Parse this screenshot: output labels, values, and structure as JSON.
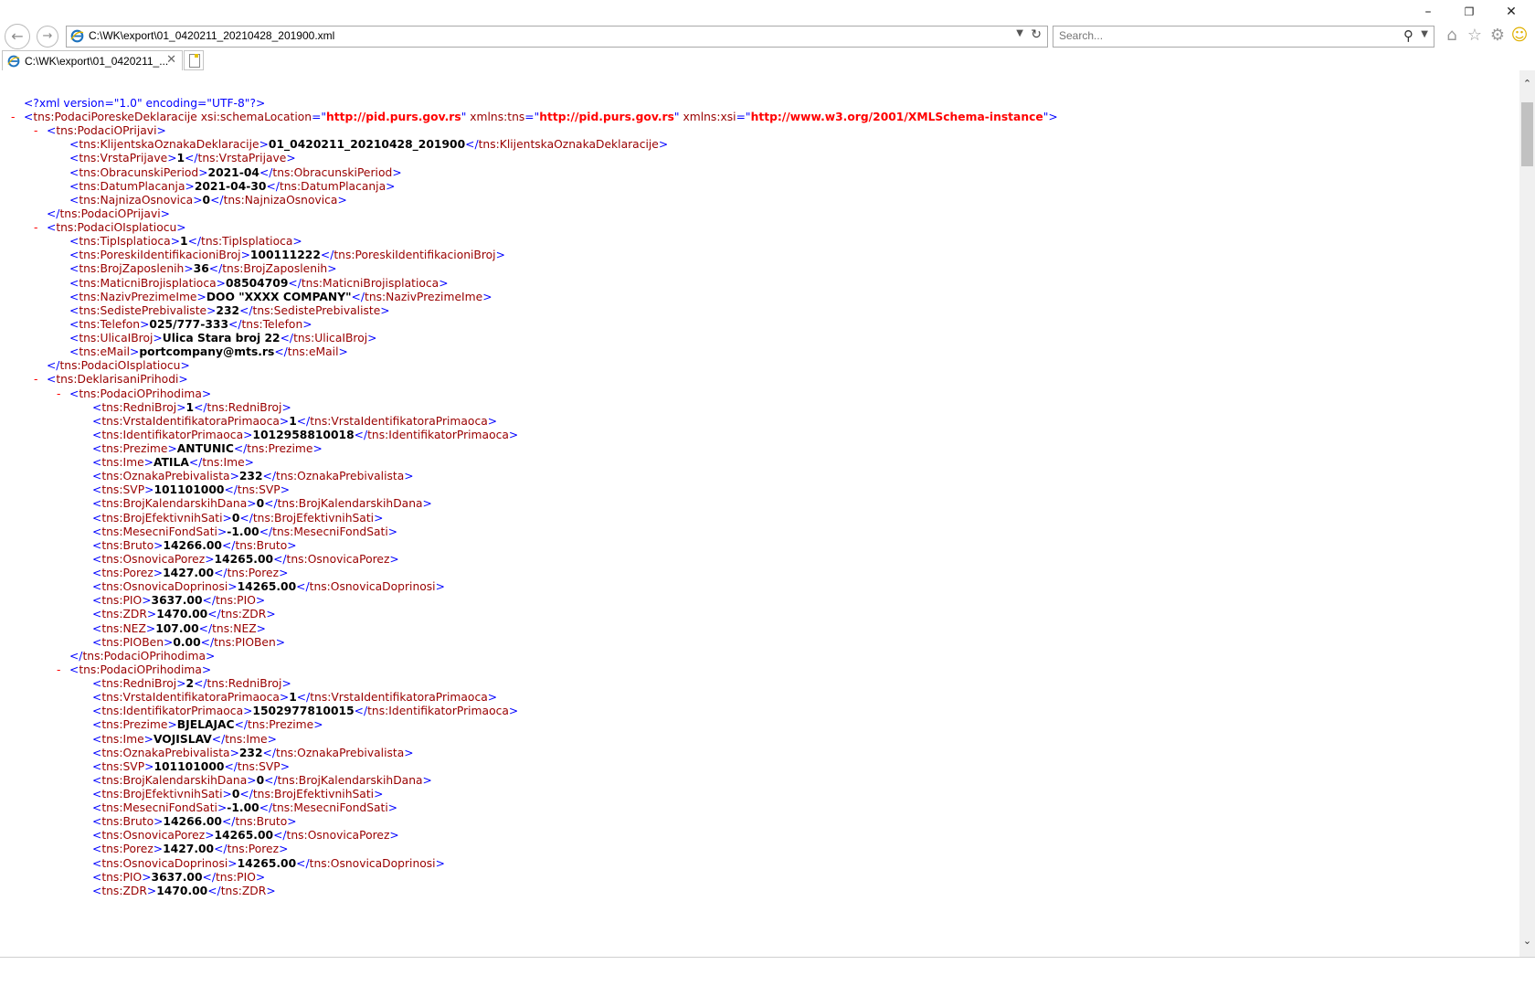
{
  "browser": {
    "address": "C:\\WK\\export\\01_0420211_20210428_201900.xml",
    "search_placeholder": "Search...",
    "tab_label": "C:\\WK\\export\\01_0420211_...",
    "window_buttons": {
      "minimize": "–",
      "restore": "❐",
      "close": "✕"
    },
    "icons": {
      "back": "back-arrow-icon",
      "forward": "forward-arrow-icon",
      "ie": "internet-explorer-icon",
      "refresh": "refresh-icon",
      "search": "search-icon",
      "home": "home-icon",
      "favorites": "star-icon",
      "tools": "gear-icon",
      "feedback": "smiley-icon",
      "new_tab": "new-tab-icon"
    },
    "accent_color": "#1e73be"
  },
  "xml": {
    "decl": "<?xml version=\"1.0\" encoding=\"UTF-8\"?>",
    "root_tag": "tns:PodaciPoreskeDeklaracije",
    "attrs": [
      {
        "name": "xsi:schemaLocation",
        "value": "http://pid.purs.gov.rs"
      },
      {
        "name": "xmlns:tns",
        "value": "http://pid.purs.gov.rs"
      },
      {
        "name": "xmlns:xsi",
        "value": "http://www.w3.org/2001/XMLSchema-instance"
      }
    ],
    "podaci_o_prijavi": {
      "tag": "tns:PodaciOPrijavi",
      "fields": [
        {
          "tag": "tns:KlijentskaOznakaDeklaracije",
          "value": "01_0420211_20210428_201900"
        },
        {
          "tag": "tns:VrstaPrijave",
          "value": "1"
        },
        {
          "tag": "tns:ObracunskiPeriod",
          "value": "2021-04"
        },
        {
          "tag": "tns:DatumPlacanja",
          "value": "2021-04-30"
        },
        {
          "tag": "tns:NajnizaOsnovica",
          "value": "0"
        }
      ]
    },
    "podaci_o_isplatiocu": {
      "tag": "tns:PodaciOIsplatiocu",
      "fields": [
        {
          "tag": "tns:TipIsplatioca",
          "value": "1"
        },
        {
          "tag": "tns:PoreskiIdentifikacioniBroj",
          "value": "100111222"
        },
        {
          "tag": "tns:BrojZaposlenih",
          "value": "36"
        },
        {
          "tag": "tns:MaticniBrojisplatioca",
          "value": "08504709"
        },
        {
          "tag": "tns:NazivPrezimeIme",
          "value": "DOO \"XXXX COMPANY\""
        },
        {
          "tag": "tns:SedistePrebivaliste",
          "value": "232"
        },
        {
          "tag": "tns:Telefon",
          "value": "025/777-333"
        },
        {
          "tag": "tns:UlicaIBroj",
          "value": "Ulica Stara broj 22"
        },
        {
          "tag": "tns:eMail",
          "value": "portcompany@mts.rs"
        }
      ]
    },
    "deklarisani_prihodi_tag": "tns:DeklarisaniPrihodi",
    "prihod_tag": "tns:PodaciOPrihodima",
    "prihodi": [
      {
        "fields": [
          {
            "tag": "tns:RedniBroj",
            "value": "1"
          },
          {
            "tag": "tns:VrstaIdentifikatoraPrimaoca",
            "value": "1"
          },
          {
            "tag": "tns:IdentifikatorPrimaoca",
            "value": "1012958810018"
          },
          {
            "tag": "tns:Prezime",
            "value": "ANTUNIC"
          },
          {
            "tag": "tns:Ime",
            "value": "ATILA"
          },
          {
            "tag": "tns:OznakaPrebivalista",
            "value": "232"
          },
          {
            "tag": "tns:SVP",
            "value": "101101000"
          },
          {
            "tag": "tns:BrojKalendarskihDana",
            "value": "0"
          },
          {
            "tag": "tns:BrojEfektivnihSati",
            "value": "0"
          },
          {
            "tag": "tns:MesecniFondSati",
            "value": "-1.00"
          },
          {
            "tag": "tns:Bruto",
            "value": "14266.00"
          },
          {
            "tag": "tns:OsnovicaPorez",
            "value": "14265.00"
          },
          {
            "tag": "tns:Porez",
            "value": "1427.00"
          },
          {
            "tag": "tns:OsnovicaDoprinosi",
            "value": "14265.00"
          },
          {
            "tag": "tns:PIO",
            "value": "3637.00"
          },
          {
            "tag": "tns:ZDR",
            "value": "1470.00"
          },
          {
            "tag": "tns:NEZ",
            "value": "107.00"
          },
          {
            "tag": "tns:PIOBen",
            "value": "0.00"
          }
        ],
        "closed": true
      },
      {
        "fields": [
          {
            "tag": "tns:RedniBroj",
            "value": "2"
          },
          {
            "tag": "tns:VrstaIdentifikatoraPrimaoca",
            "value": "1"
          },
          {
            "tag": "tns:IdentifikatorPrimaoca",
            "value": "1502977810015"
          },
          {
            "tag": "tns:Prezime",
            "value": "BJELAJAC"
          },
          {
            "tag": "tns:Ime",
            "value": "VOJISLAV"
          },
          {
            "tag": "tns:OznakaPrebivalista",
            "value": "232"
          },
          {
            "tag": "tns:SVP",
            "value": "101101000"
          },
          {
            "tag": "tns:BrojKalendarskihDana",
            "value": "0"
          },
          {
            "tag": "tns:BrojEfektivnihSati",
            "value": "0"
          },
          {
            "tag": "tns:MesecniFondSati",
            "value": "-1.00"
          },
          {
            "tag": "tns:Bruto",
            "value": "14266.00"
          },
          {
            "tag": "tns:OsnovicaPorez",
            "value": "14265.00"
          },
          {
            "tag": "tns:Porez",
            "value": "1427.00"
          },
          {
            "tag": "tns:OsnovicaDoprinosi",
            "value": "14265.00"
          },
          {
            "tag": "tns:PIO",
            "value": "3637.00"
          },
          {
            "tag": "tns:ZDR",
            "value": "1470.00"
          }
        ],
        "closed": false
      }
    ]
  }
}
